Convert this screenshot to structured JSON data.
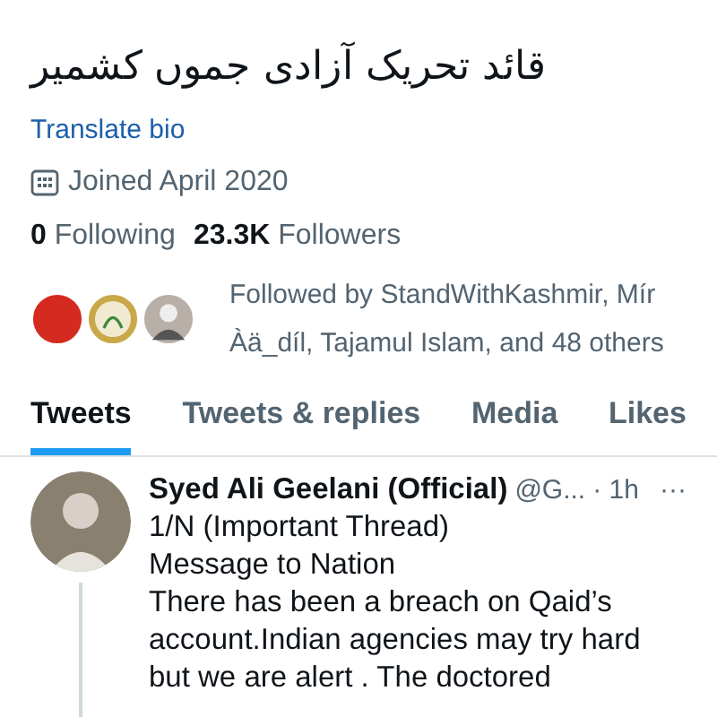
{
  "profile": {
    "bio": "قائد تحریک آزادی جموں کشمیر",
    "translate_link": "Translate bio",
    "joined": "Joined April 2020",
    "following_count": "0",
    "following_label": "Following",
    "followers_count": "23.3K",
    "followers_label": "Followers",
    "followed_by": {
      "text": "Followed by StandWithKashmir, Mír Àä_díl, Tajamul Islam, and 48 others",
      "avatars": [
        {
          "kind": "plain",
          "color": "#d42a20"
        },
        {
          "kind": "emblem",
          "color": "#c9a84a"
        },
        {
          "kind": "person",
          "color": "#b8b0a8"
        }
      ]
    }
  },
  "tabs": [
    {
      "label": "Tweets",
      "selected": true
    },
    {
      "label": "Tweets & replies",
      "selected": false
    },
    {
      "label": "Media",
      "selected": false
    },
    {
      "label": "Likes",
      "selected": false
    }
  ],
  "tweet": {
    "name": "Syed Ali Geelani (Official)",
    "handle": "@G...",
    "time": "· 1h",
    "more": "···",
    "paragraphs": [
      "1/N (Important Thread)",
      "Message to Nation",
      "There has been a breach on Qaid’s account.Indian agencies may try hard but we are alert . The doctored"
    ]
  }
}
